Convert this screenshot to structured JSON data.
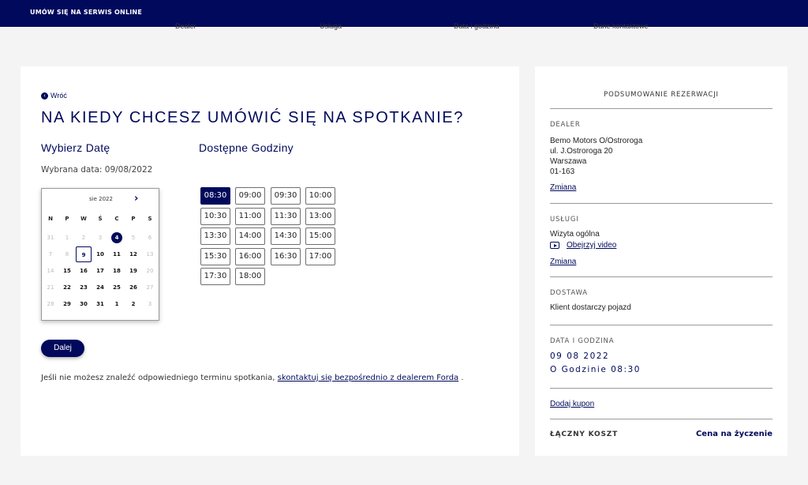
{
  "header": {
    "title": "UMÓW SIĘ NA SERWIS ONLINE"
  },
  "steps": [
    "Dealer",
    "Usługa",
    "Data i godzina",
    "Dane kontaktowe"
  ],
  "main": {
    "back_label": "Wróć",
    "headline": "NA KIEDY CHCESZ UMÓWIĆ SIĘ NA SPOTKANIE?",
    "date_title": "Wybierz Datę",
    "hours_title": "Dostępne Godziny",
    "selected_date": "Wybrana data: 09/08/2022",
    "next_button": "Dalej",
    "footer_text": "Jeśli nie możesz znaleźć odpowiedniego terminu spotkania,",
    "footer_link": "skontaktuj się bezpośrednio z dealerem Forda",
    "footer_end": "."
  },
  "calendar": {
    "month": "sie 2022",
    "next_icon": "chevron-right-icon",
    "weekdays": [
      "N",
      "P",
      "W",
      "Ś",
      "C",
      "P",
      "S"
    ],
    "weeks": [
      [
        "31",
        "1",
        "2",
        "3",
        "4",
        "5",
        "6"
      ],
      [
        "7",
        "8",
        "9",
        "10",
        "11",
        "12",
        "13"
      ],
      [
        "14",
        "15",
        "16",
        "17",
        "18",
        "19",
        "20"
      ],
      [
        "21",
        "22",
        "23",
        "24",
        "25",
        "26",
        "27"
      ],
      [
        "28",
        "29",
        "30",
        "31",
        "1",
        "2",
        "3"
      ]
    ],
    "muted": [
      [
        0,
        0
      ],
      [
        0,
        1
      ],
      [
        0,
        2
      ],
      [
        0,
        3
      ],
      [
        0,
        5
      ],
      [
        0,
        6
      ],
      [
        1,
        0
      ],
      [
        1,
        1
      ],
      [
        1,
        6
      ],
      [
        2,
        0
      ],
      [
        2,
        6
      ],
      [
        3,
        0
      ],
      [
        3,
        6
      ],
      [
        4,
        0
      ],
      [
        4,
        6
      ]
    ],
    "today": [
      0,
      4
    ],
    "selected": [
      1,
      2
    ]
  },
  "slots": [
    "08:30",
    "09:00",
    "09:30",
    "10:00",
    "10:30",
    "11:00",
    "11:30",
    "13:00",
    "13:30",
    "14:00",
    "14:30",
    "15:00",
    "15:30",
    "16:00",
    "16:30",
    "17:00",
    "17:30",
    "18:00"
  ],
  "active_slot": "08:30",
  "summary": {
    "title": "PODSUMOWANIE REZERWACJI",
    "dealer_label": "DEALER",
    "dealer_name": "Bemo Motors O/Ostroroga",
    "dealer_street": "ul. J.Ostroroga 20",
    "dealer_city": "Warszawa",
    "dealer_zip": "01-163",
    "change_label": "Zmiana",
    "services_label": "USŁUGI",
    "service_name": "Wizyta ogólna",
    "video_label": "Obejrzyj video",
    "change_label_2": "Zmiana",
    "delivery_label": "DOSTAWA",
    "delivery_value": "Klient dostarczy pojazd",
    "datetime_label": "DATA I GODZINA",
    "date_value": "09 08 2022",
    "time_value": "O Godzinie 08:30",
    "coupon_label": "Dodaj kupon",
    "total_label": "ŁĄCZNY KOSZT",
    "total_value": "Cena na życzenie"
  },
  "colors": {
    "brand": "#00095b",
    "background": "#f4f4f4"
  }
}
